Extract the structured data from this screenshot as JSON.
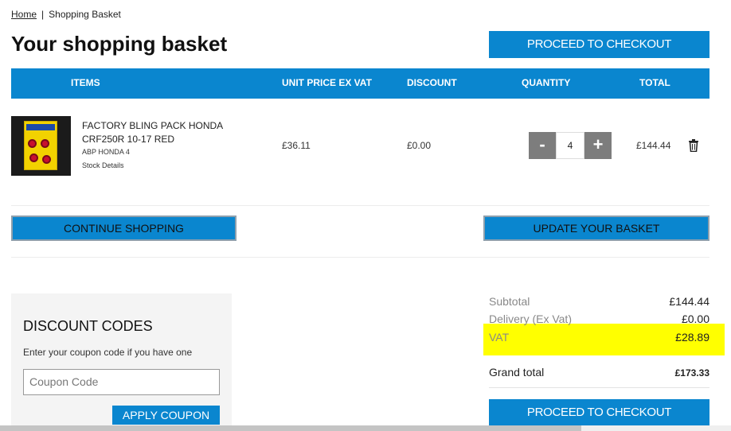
{
  "breadcrumb": {
    "home": "Home",
    "separator": "|",
    "current": "Shopping Basket"
  },
  "page_title": "Your shopping basket",
  "checkout_label": "PROCEED TO CHECKOUT",
  "table": {
    "headers": {
      "items": "ITEMS",
      "unit_price": "UNIT PRICE EX VAT",
      "discount": "DISCOUNT",
      "quantity": "QUANTITY",
      "total": "TOTAL"
    }
  },
  "item": {
    "name": "FACTORY BLING PACK HONDA CRF250R 10-17 RED",
    "code": "ABP HONDA 4",
    "stock_link": "Stock Details",
    "unit_price": "£36.11",
    "discount": "£0.00",
    "quantity": "4",
    "total": "£144.44",
    "minus": "-",
    "plus": "+"
  },
  "actions": {
    "continue": "CONTINUE SHOPPING",
    "update": "UPDATE YOUR BASKET"
  },
  "discount_codes": {
    "title": "DISCOUNT CODES",
    "instruction": "Enter your coupon code if you have one",
    "placeholder": "Coupon Code",
    "apply": "APPLY COUPON"
  },
  "summary": {
    "subtotal_label": "Subtotal",
    "subtotal": "£144.44",
    "delivery_label": "Delivery (Ex Vat)",
    "delivery": "£0.00",
    "vat_label": "VAT",
    "vat": "£28.89",
    "grand_label": "Grand total",
    "grand": "£173.33"
  },
  "colors": {
    "accent": "#0a86cf",
    "highlight": "#ffff00",
    "qty_button": "#7d7d7d"
  }
}
